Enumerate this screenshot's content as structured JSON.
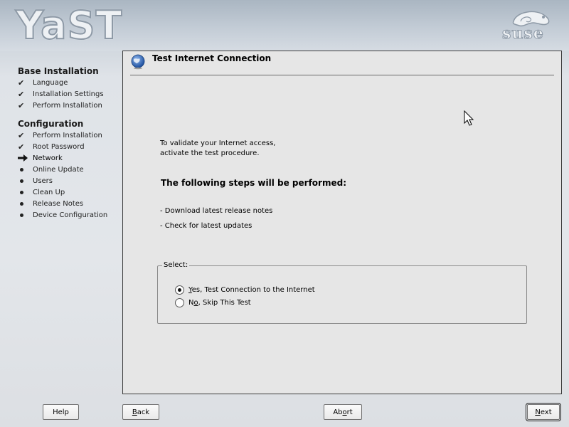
{
  "window": {
    "logo_text": "YaST",
    "brand_text": "suse"
  },
  "sidebar": {
    "sections": [
      {
        "title": "Base Installation",
        "steps": [
          {
            "label": "Language",
            "status": "done"
          },
          {
            "label": "Installation Settings",
            "status": "done"
          },
          {
            "label": "Perform Installation",
            "status": "done"
          }
        ]
      },
      {
        "title": "Configuration",
        "steps": [
          {
            "label": "Perform Installation",
            "status": "done"
          },
          {
            "label": "Root Password",
            "status": "done"
          },
          {
            "label": "Network",
            "status": "current"
          },
          {
            "label": "Online Update",
            "status": "todo"
          },
          {
            "label": "Users",
            "status": "todo"
          },
          {
            "label": "Clean Up",
            "status": "todo"
          },
          {
            "label": "Release Notes",
            "status": "todo"
          },
          {
            "label": "Device Configuration",
            "status": "todo"
          }
        ]
      }
    ]
  },
  "panel": {
    "title": "Test Internet Connection",
    "icon": "globe-icon",
    "intro_line1": "To validate your Internet access,",
    "intro_line2": "activate the test procedure.",
    "steps_heading": "The following steps will be performed:",
    "items": [
      "- Download latest release notes",
      "- Check for latest updates"
    ],
    "group": {
      "legend": "Select:",
      "options": [
        {
          "label": "Yes, Test Connection to the Internet",
          "mnemonic": "Y",
          "rest": "es, Test Connection to the Internet",
          "selected": true
        },
        {
          "label": "No, Skip This Test",
          "mnemonic": "o",
          "prefix": "N",
          "rest": ", Skip This Test",
          "selected": false
        }
      ]
    }
  },
  "buttons": {
    "help": "Help",
    "back_mnemonic": "B",
    "back_rest": "ack",
    "abort_prefix": "Ab",
    "abort_mnemonic": "o",
    "abort_rest": "rt",
    "next_mnemonic": "N",
    "next_rest": "ext"
  },
  "colors": {
    "panel_bg": "#e6e6e6",
    "banner": "#c3ccd6"
  }
}
